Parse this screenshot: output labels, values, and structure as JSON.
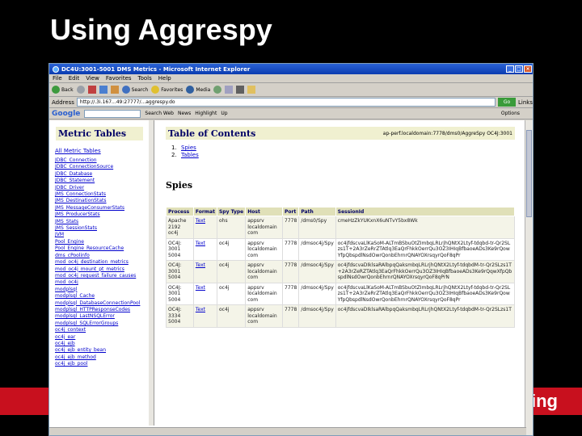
{
  "slide": {
    "title": "Using Aggrespy",
    "band_text": "ing"
  },
  "window": {
    "title": "DC4U:3001-5001 DMS Metrics - Microsoft Internet Explorer",
    "buttons": [
      "_",
      "□",
      "×"
    ]
  },
  "menu": [
    "File",
    "Edit",
    "View",
    "Favorites",
    "Tools",
    "Help"
  ],
  "toolbar": {
    "back": "Back",
    "search": "Search",
    "favorites": "Favorites",
    "media": "Media"
  },
  "address": {
    "label": "Address",
    "value": "http://.3i.167...49:27777/...aggrespy.do",
    "go": "Go",
    "links": "Links"
  },
  "google": {
    "logo": "Google",
    "search_web": "Search Web",
    "news": "News",
    "up": "Up",
    "highlight": "Highlight",
    "options": "Options"
  },
  "left_frame": {
    "title": "Metric Tables",
    "all_link": "All Metric Tables",
    "links": [
      "JDBC_Connection",
      "JDBC_ConnectionSource",
      "JDBC_Database",
      "JDBC_Statement",
      "JDBC_Driver",
      "JMS_ConnectionStats",
      "JMS_DestinationStats",
      "JMS_MessageConsumerStats",
      "JMS_ProducerStats",
      "JMS_Stats",
      "JMS_SessionStats",
      "JVM",
      "Pool_Engine",
      "Pool_Engine_ResourceCache",
      "dms_cPoolinfo",
      "mod_oc4j_destination_metrics",
      "mod_oc4j_mount_pt_metrics",
      "mod_oc4j_request_failure_causes",
      "mod_oc4j",
      "modplsql",
      "modplsql_Cache",
      "modplsql_DatabaseConnectionPool",
      "modplsql_HTTPResponseCodes",
      "modplsql_LastNSQLError",
      "modplsql_SQLErrorGroups",
      "oc4j_context",
      "oc4j_ear",
      "oc4j_ejb",
      "oc4j_ejb_entity_bean",
      "oc4j_ejb_method",
      "oc4j_ejb_pool"
    ]
  },
  "right_frame": {
    "toc_title": "Table of Contents",
    "toc_url": "ap-perf.localdomain:7778/dms0/AggreSpy OC4J:3001",
    "toc_items": [
      "Spies",
      "Tables"
    ],
    "section": "Spies",
    "columns": [
      "Process",
      "Format",
      "Spy Type",
      "Host",
      "Port",
      "Path",
      "SessionId"
    ],
    "rows": [
      {
        "process": "Apache 2192 oc4j",
        "format": "Text",
        "type": "ohs",
        "host": "appsrv localdomain com",
        "port": "7778",
        "path": "/dms0/Spy",
        "session": "cmeHzZkYUKxnX6uNTvY5bx8Wk"
      },
      {
        "process": "OC4J: 3001 5004",
        "format": "Text",
        "type": "oc4j",
        "host": "appsrv localdomain com",
        "port": "7778",
        "path": "/dmsoc4j/Spy",
        "session": "oc4jfdscvaLlKaSoM-ALTmBSbuOtZImbqLRLrjhQNtX2Ltyf-tdqbd-tr-Qr2SLzs1T+2A3rZeRrZTAtlq3EaQrFhkkOerrQu3OZ3IHIqBfbaoeADs3Ke9rQowYfpQbspdlNsdOwrQonbEhrnrQNAYOXrsqyrQoF8qPr"
      },
      {
        "process": "OC4J: 3001 5004",
        "format": "Text",
        "type": "oc4j",
        "host": "appsrv localdomain com",
        "port": "7778",
        "path": "/dmsoc4j/Spy",
        "session": "oc4jfdscvaDIklsaRAlbpqQaksmbqLRLrjhQNtX2Ltyf-tdqbdM-tr-Qr2SLzs1T+2A3rZeRZTAtlq3EaQrFhkkOerrQu3OZ3IHIqBfbaoeADs3Ke9rQqwXfpQbspdlNsdOwrQonbEhrnrQNAYOXrsqyrQoF8qPrN"
      },
      {
        "process": "OC4J: 3001 5004",
        "format": "Text",
        "type": "oc4j",
        "host": "appsrv localdomain com",
        "port": "7778",
        "path": "/dmsoc4j/Spy",
        "session": "oc4jfdscvaLlKaSoM-ALTmBSbuOtZImbqLRLrjhQNtX2Ltyf-tdqbd-tr-Qr2SLzs1T+2A3rZeRrZTAtlq3EaQrFhkkOerrQu3OZ3IHIqBfbaoeADs3Ke9rQowYfpQbspdlNsdOwrQonbEhrnrQNAYOXrsqyrQoF8qPr"
      },
      {
        "process": "OC4J: 3334 5004",
        "format": "Text",
        "type": "oc4j",
        "host": "appsrv localdomain com",
        "port": "7778",
        "path": "/dmsoc4j/Spy",
        "session": "oc4jfdscvaDIklsaRAlbpqQaksmbqLRLrjhQNtX2Ltyf-tdqbdM-tr-Qr2SLzs1T"
      }
    ]
  }
}
